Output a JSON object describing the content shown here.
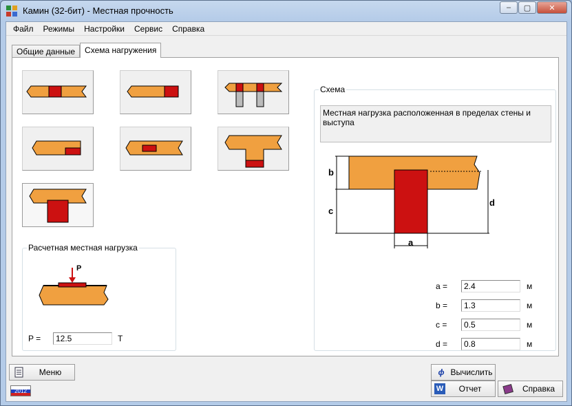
{
  "window": {
    "title": "Камин (32-бит) - Местная прочность",
    "controls": {
      "minimize": "–",
      "maximize": "▢",
      "close": "✕"
    }
  },
  "menu": [
    "Файл",
    "Режимы",
    "Настройки",
    "Сервис",
    "Справка"
  ],
  "tabs": [
    {
      "label": "Общие данные",
      "active": false
    },
    {
      "label": "Схема нагружения",
      "active": true
    }
  ],
  "scheme_buttons": [
    "scheme-1",
    "scheme-2",
    "scheme-3",
    "scheme-4",
    "scheme-5",
    "scheme-6",
    "scheme-7"
  ],
  "load_group": {
    "title": "Расчетная местная нагрузка",
    "diagram_label": "P",
    "p_label": "P =",
    "p_value": "12.5",
    "p_unit": "Т"
  },
  "schema_group": {
    "title": "Схема",
    "description": "Местная нагрузка расположенная в пределах стены и выступа",
    "diagram_labels": {
      "a": "a",
      "b": "b",
      "c": "c",
      "d": "d"
    }
  },
  "params": [
    {
      "label": "a =",
      "value": "2.4",
      "unit": "м"
    },
    {
      "label": "b =",
      "value": "1.3",
      "unit": "м"
    },
    {
      "label": "c =",
      "value": "0.5",
      "unit": "м"
    },
    {
      "label": "d =",
      "value": "0.8",
      "unit": "м"
    }
  ],
  "buttons": {
    "menu": "Меню",
    "calculate": "Вычислить",
    "report": "Отчет",
    "help": "Справка"
  },
  "version_badge": "2012",
  "colors": {
    "brick": "#f0a040",
    "load_red": "#cc1111",
    "outline": "#000000"
  }
}
